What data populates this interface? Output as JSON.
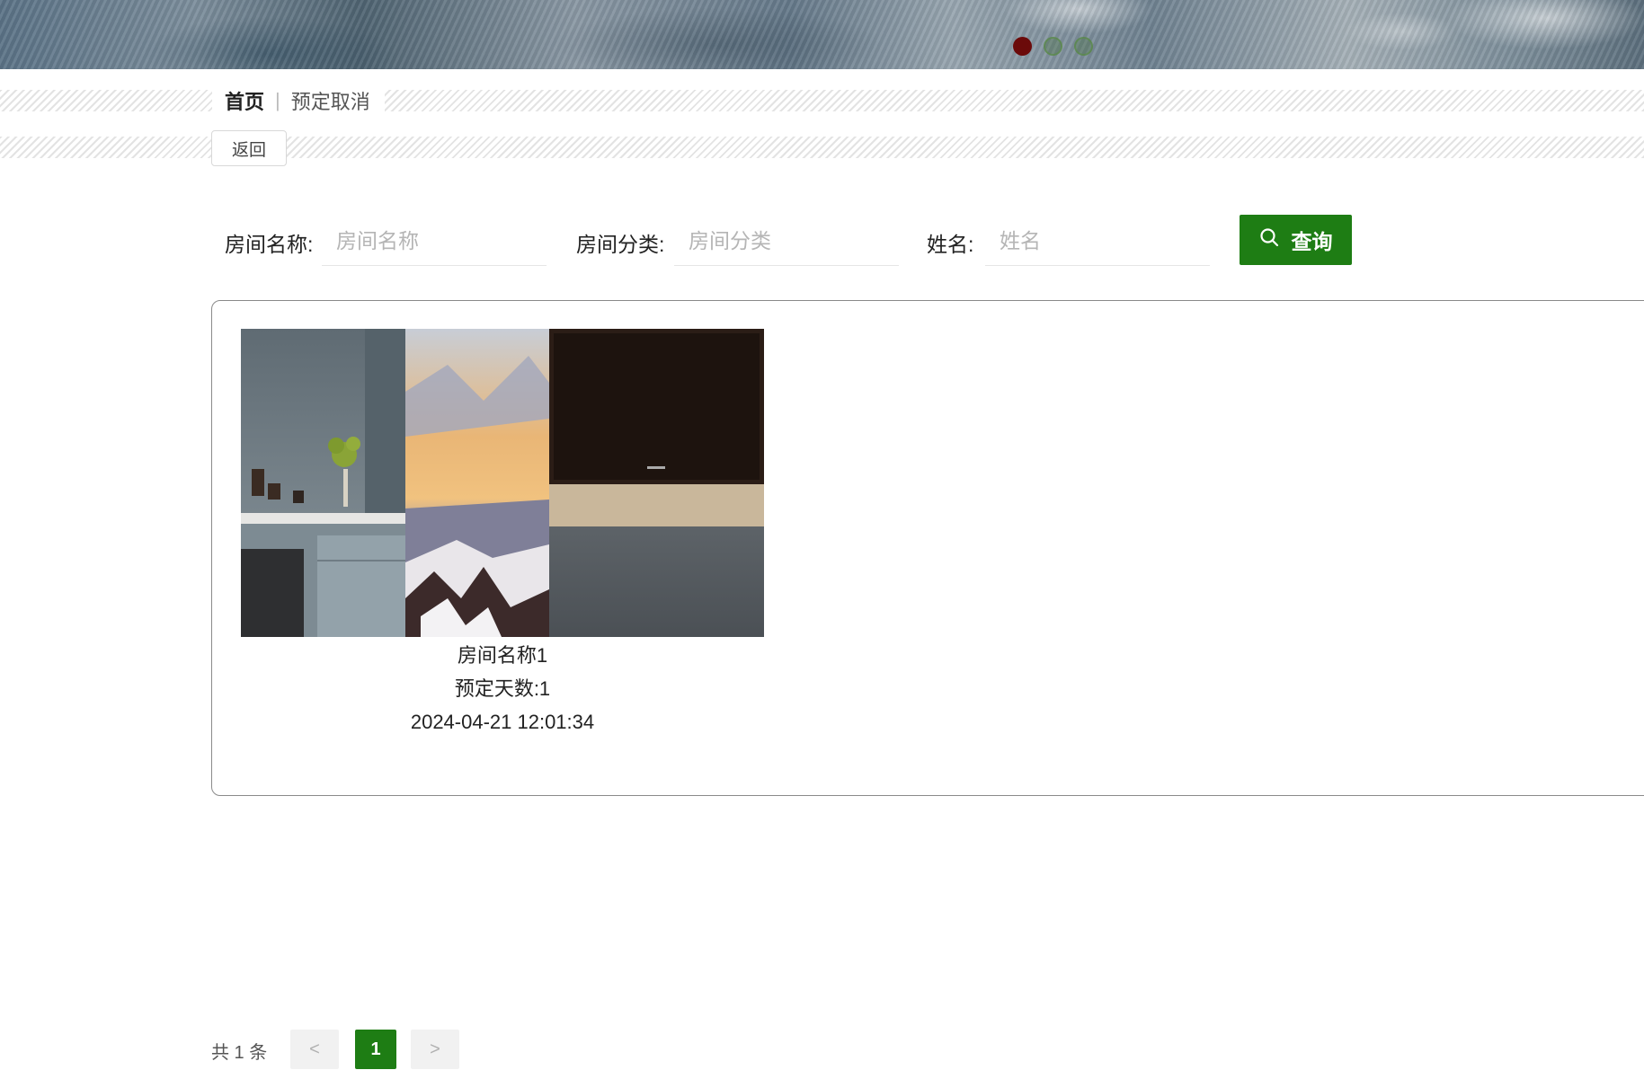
{
  "banner": {
    "carousel_count": 3,
    "active_index": 0
  },
  "breadcrumb": {
    "home": "首页",
    "separator": "|",
    "current": "预定取消"
  },
  "back_button": "返回",
  "search": {
    "fields": [
      {
        "label": "房间名称:",
        "placeholder": "房间名称",
        "value": ""
      },
      {
        "label": "房间分类:",
        "placeholder": "房间分类",
        "value": ""
      },
      {
        "label": "姓名:",
        "placeholder": "姓名",
        "value": ""
      }
    ],
    "button_label": "查询",
    "button_icon": "search-icon"
  },
  "results": [
    {
      "name": "房间名称1",
      "days": "预定天数:1",
      "time": "2024-04-21 12:01:34"
    }
  ],
  "pagination": {
    "total_text": "共 1 条",
    "prev": "<",
    "current": "1",
    "next": ">"
  },
  "colors": {
    "primary": "#1e7d14",
    "active_dot": "#6b0a0a"
  }
}
